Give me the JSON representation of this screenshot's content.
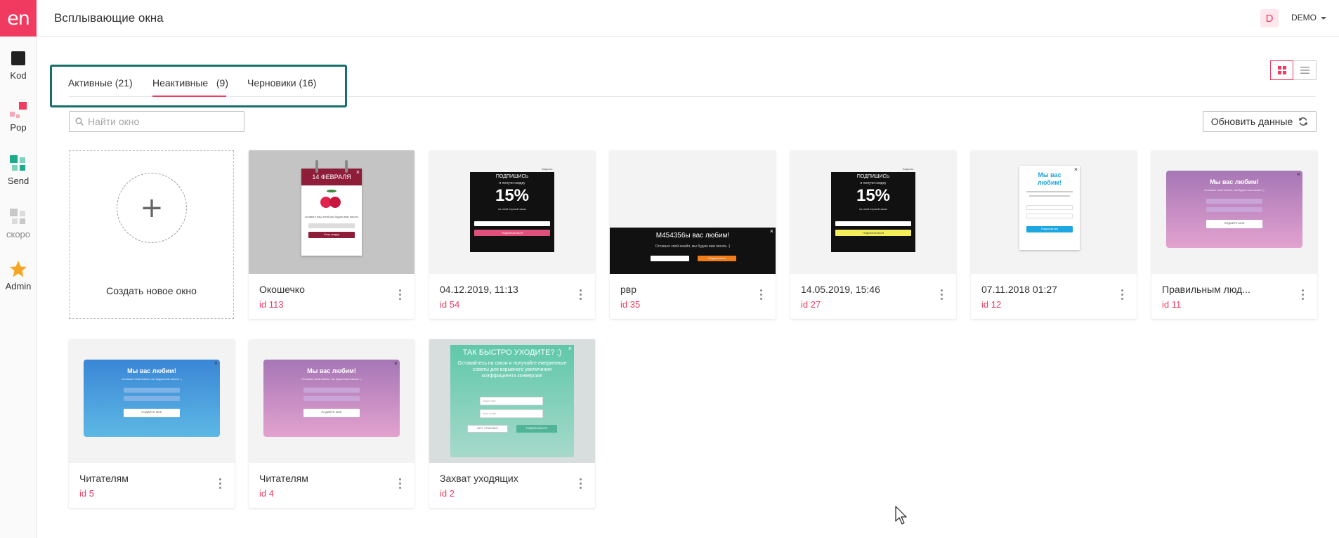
{
  "app": {
    "logo_text": "en",
    "brand_color": "#f03a5f"
  },
  "sidebar": {
    "items": [
      {
        "label": "Kod",
        "icon": "square-icon",
        "color": "#222222"
      },
      {
        "label": "Pop",
        "icon": "popups-icon",
        "color": "#f03a5f"
      },
      {
        "label": "Send",
        "icon": "send-grid-icon",
        "color": "#1aab8a"
      },
      {
        "label": "скоро",
        "icon": "grey-grid-icon",
        "color": "#bbbbbb"
      },
      {
        "label": "Admin",
        "icon": "star-icon",
        "color": "#f5a623"
      }
    ]
  },
  "header": {
    "title": "Всплывающие окна",
    "avatar_letter": "D",
    "account": "DEMO"
  },
  "tabs": [
    {
      "label": "Активные (21)",
      "active": false
    },
    {
      "label": "Неактивные   (9)",
      "active": true
    },
    {
      "label": "Черновики (16)",
      "active": false
    }
  ],
  "toolbar": {
    "search_placeholder": "Найти окно",
    "refresh_label": "Обновить данные"
  },
  "create": {
    "label": "Создать новое окно"
  },
  "cards": [
    {
      "name": "Окошечко",
      "id": "id 113"
    },
    {
      "name": "04.12.2019, 11:13",
      "id": "id 54"
    },
    {
      "name": "рвр",
      "id": "id 35"
    },
    {
      "name": "14.05.2019, 15:46",
      "id": "id 27"
    },
    {
      "name": "07.11.2018 01:27",
      "id": "id 12"
    },
    {
      "name": "Правильным люд...",
      "id": "id 11"
    },
    {
      "name": "Читателям",
      "id": "id 5"
    },
    {
      "name": "Читателям",
      "id": "id 4"
    },
    {
      "name": "Захват уходящих",
      "id": "id 2"
    }
  ],
  "previews": {
    "calendar_title": "14 ФЕВРАЛЯ",
    "calendar_text": "оставьте ваш email,мы будем вам писать",
    "calendar_btn": "Хочу скидку",
    "subscribe_head": "ПОДПИШИСЬ",
    "subscribe_sub": "и получи скидку",
    "subscribe_big": "15%",
    "subscribe_note": "на свой первый заказ",
    "subscribe_btn": "ПОДПИСАТЬСЯ",
    "subscribe_close": "Закрыть",
    "dark_title": "M454356ы вас любим!",
    "dark_text": "Оставьте свой емейл, мы будем вам писать :)",
    "dark_btn": "Подписаться",
    "love_title": "Мы вас любим!",
    "love_text": "Оставьте свой емейл, мы будем вам писать :)",
    "love_btn": "ПОДАЙТЕ МНЕ",
    "narrow_title": "Мы вас любим!",
    "narrow_btn": "Подписаться",
    "exit_title": "ТАК БЫСТРО УХОДИТЕ? ;)",
    "exit_text": "Оставайтесь на связи и получайте ежедневные советы для взрывного увеличения коэффициента конверсии!",
    "exit_field1": "Ваше имя",
    "exit_field2": "Ваш email",
    "exit_btn_no": "НЕТ, СПАСИБО",
    "exit_btn_yes": "ПОДПИСАТЬСЯ"
  }
}
